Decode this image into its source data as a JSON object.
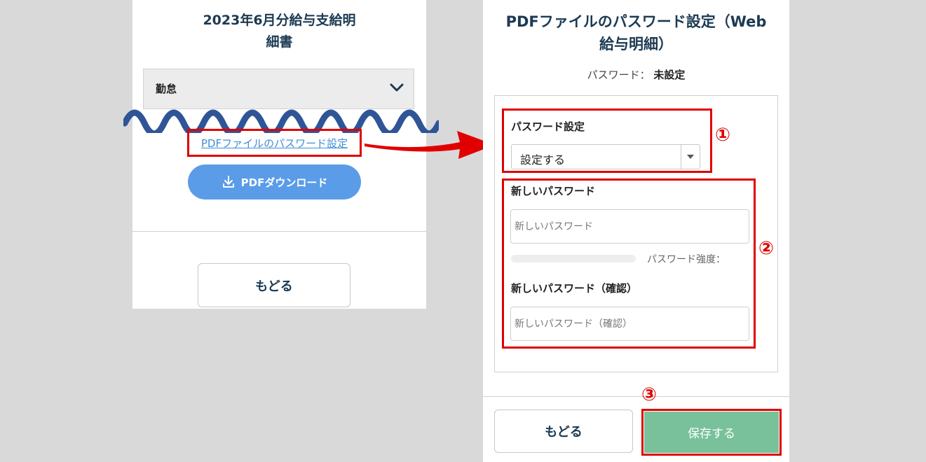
{
  "payslip": {
    "title_line1": "2023年6月分給与支給明",
    "title_line2": "細書",
    "category_label": "勤怠",
    "pdf_password_link": "PDFファイルのパスワード設定",
    "download_label": "PDFダウンロード",
    "back_label": "もどる"
  },
  "password_form": {
    "title_line1": "PDFファイルのパスワード設定（Web",
    "title_line2": "給与明細）",
    "status_label": "パスワード：",
    "status_value": "未設定",
    "setting_label": "パスワード設定",
    "setting_value": "設定する",
    "new_password_label": "新しいパスワード",
    "new_password_placeholder": "新しいパスワード",
    "strength_label": "パスワード強度：",
    "confirm_label": "新しいパスワード（確認）",
    "confirm_placeholder": "新しいパスワード（確認）",
    "back_label": "もどる",
    "save_label": "保存する"
  },
  "annotations": {
    "step1": "①",
    "step2": "②",
    "step3": "③"
  },
  "colors": {
    "highlight_red": "#e00000",
    "download_blue": "#5a9ce8",
    "save_green": "#78c19a",
    "wave_blue": "#2f5597",
    "title_navy": "#1c3a52"
  }
}
